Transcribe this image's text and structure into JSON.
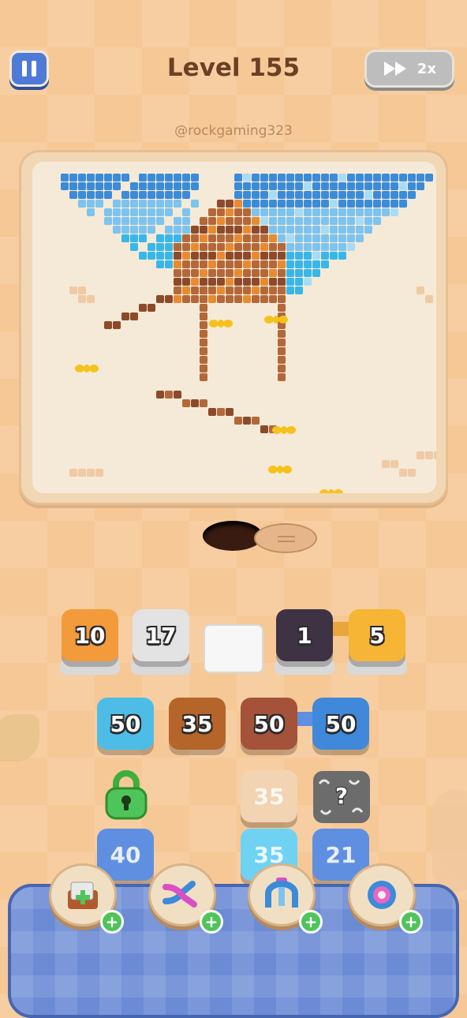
{
  "header": {
    "level_title": "Level 155",
    "speed_label": "2x",
    "watermark": "@rockgaming323"
  },
  "icons": {
    "pause": "pause-icon",
    "fast_forward": "fast-forward-icon",
    "lock": "lock-icon",
    "mystery": "question-mark-icon",
    "boosters": [
      "add-tray-icon",
      "shuffle-arrows-icon",
      "magnet-claw-icon",
      "pink-donut-icon"
    ]
  },
  "queue": {
    "row1": [
      {
        "value": "10",
        "color": "#f39a3a"
      },
      {
        "value": "17",
        "color": "#e3e3e3"
      },
      {
        "value": "",
        "color": "#f7f7f7"
      },
      {
        "value": "1",
        "color": "#3e3344"
      },
      {
        "value": "5",
        "color": "#f6b534"
      }
    ],
    "row2": [
      {
        "value": "50",
        "color": "#4dbde7"
      },
      {
        "value": "35",
        "color": "#b5642a"
      },
      {
        "value": "50",
        "color": "#a5523a"
      },
      {
        "value": "50",
        "color": "#3f88da"
      }
    ],
    "row3": [
      {
        "value": "35",
        "color": "#f2d3b2"
      }
    ],
    "row4": [
      {
        "value": "40",
        "color": "#5f8fe0"
      },
      {
        "value": "35",
        "color": "#6fd2f3"
      },
      {
        "value": "21",
        "color": "#5f8fe0"
      }
    ]
  },
  "colors": {
    "sky_blue": "#7cc4ef",
    "light_blue": "#a8dcf5",
    "cyan": "#37b7e9",
    "blue": "#3b8bd9",
    "brown": "#b3683a",
    "dark_brown": "#8c4a2a",
    "orange": "#e88a2f",
    "peach": "#f1c9a4",
    "ant_yellow": "#f5c21c"
  }
}
